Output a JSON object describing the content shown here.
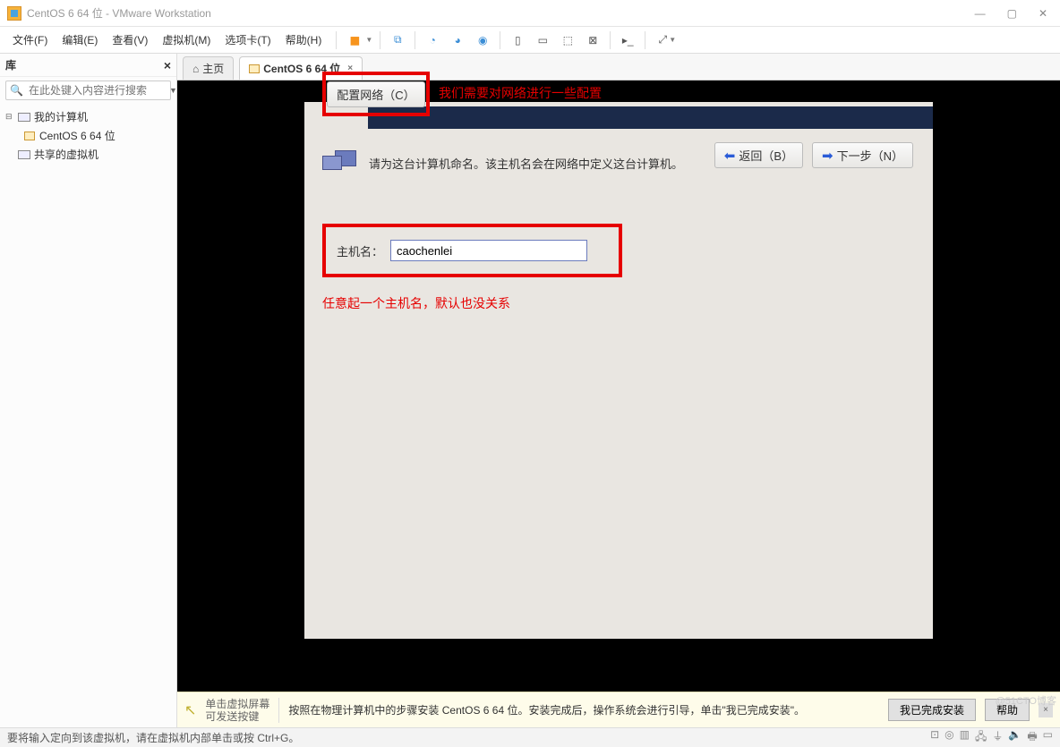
{
  "titlebar": {
    "title": "CentOS 6 64 位 - VMware Workstation"
  },
  "menubar": {
    "items": [
      {
        "label": "文件(F)"
      },
      {
        "label": "编辑(E)"
      },
      {
        "label": "查看(V)"
      },
      {
        "label": "虚拟机(M)"
      },
      {
        "label": "选项卡(T)"
      },
      {
        "label": "帮助(H)"
      }
    ]
  },
  "sidebar": {
    "title": "库",
    "search_placeholder": "在此处键入内容进行搜索",
    "tree": {
      "root_label": "我的计算机",
      "vm_label": "CentOS 6 64 位",
      "shared_label": "共享的虚拟机"
    }
  },
  "tabs": {
    "home": "主页",
    "vm": "CentOS 6 64 位"
  },
  "installer": {
    "prompt": "请为这台计算机命名。该主机名会在网络中定义这台计算机。",
    "hostname_label": "主机名：",
    "hostname_value": "caochenlei",
    "annotation1": "任意起一个主机名，默认也没关系",
    "config_btn": "配置网络（C）",
    "annotation2": "我们需要对网络进行一些配置",
    "back_btn": "返回（B）",
    "next_btn": "下一步（N）"
  },
  "infobar": {
    "left_line1": "单击虚拟屏幕",
    "left_line2": "可发送按键",
    "main": "按照在物理计算机中的步骤安装 CentOS 6 64 位。安装完成后，操作系统会进行引导，单击\"我已完成安装\"。",
    "done_btn": "我已完成安装",
    "help_btn": "帮助"
  },
  "statusbar": {
    "text": "要将输入定向到该虚拟机，请在虚拟机内部单击或按 Ctrl+G。"
  },
  "watermark": "@51CTO博客"
}
